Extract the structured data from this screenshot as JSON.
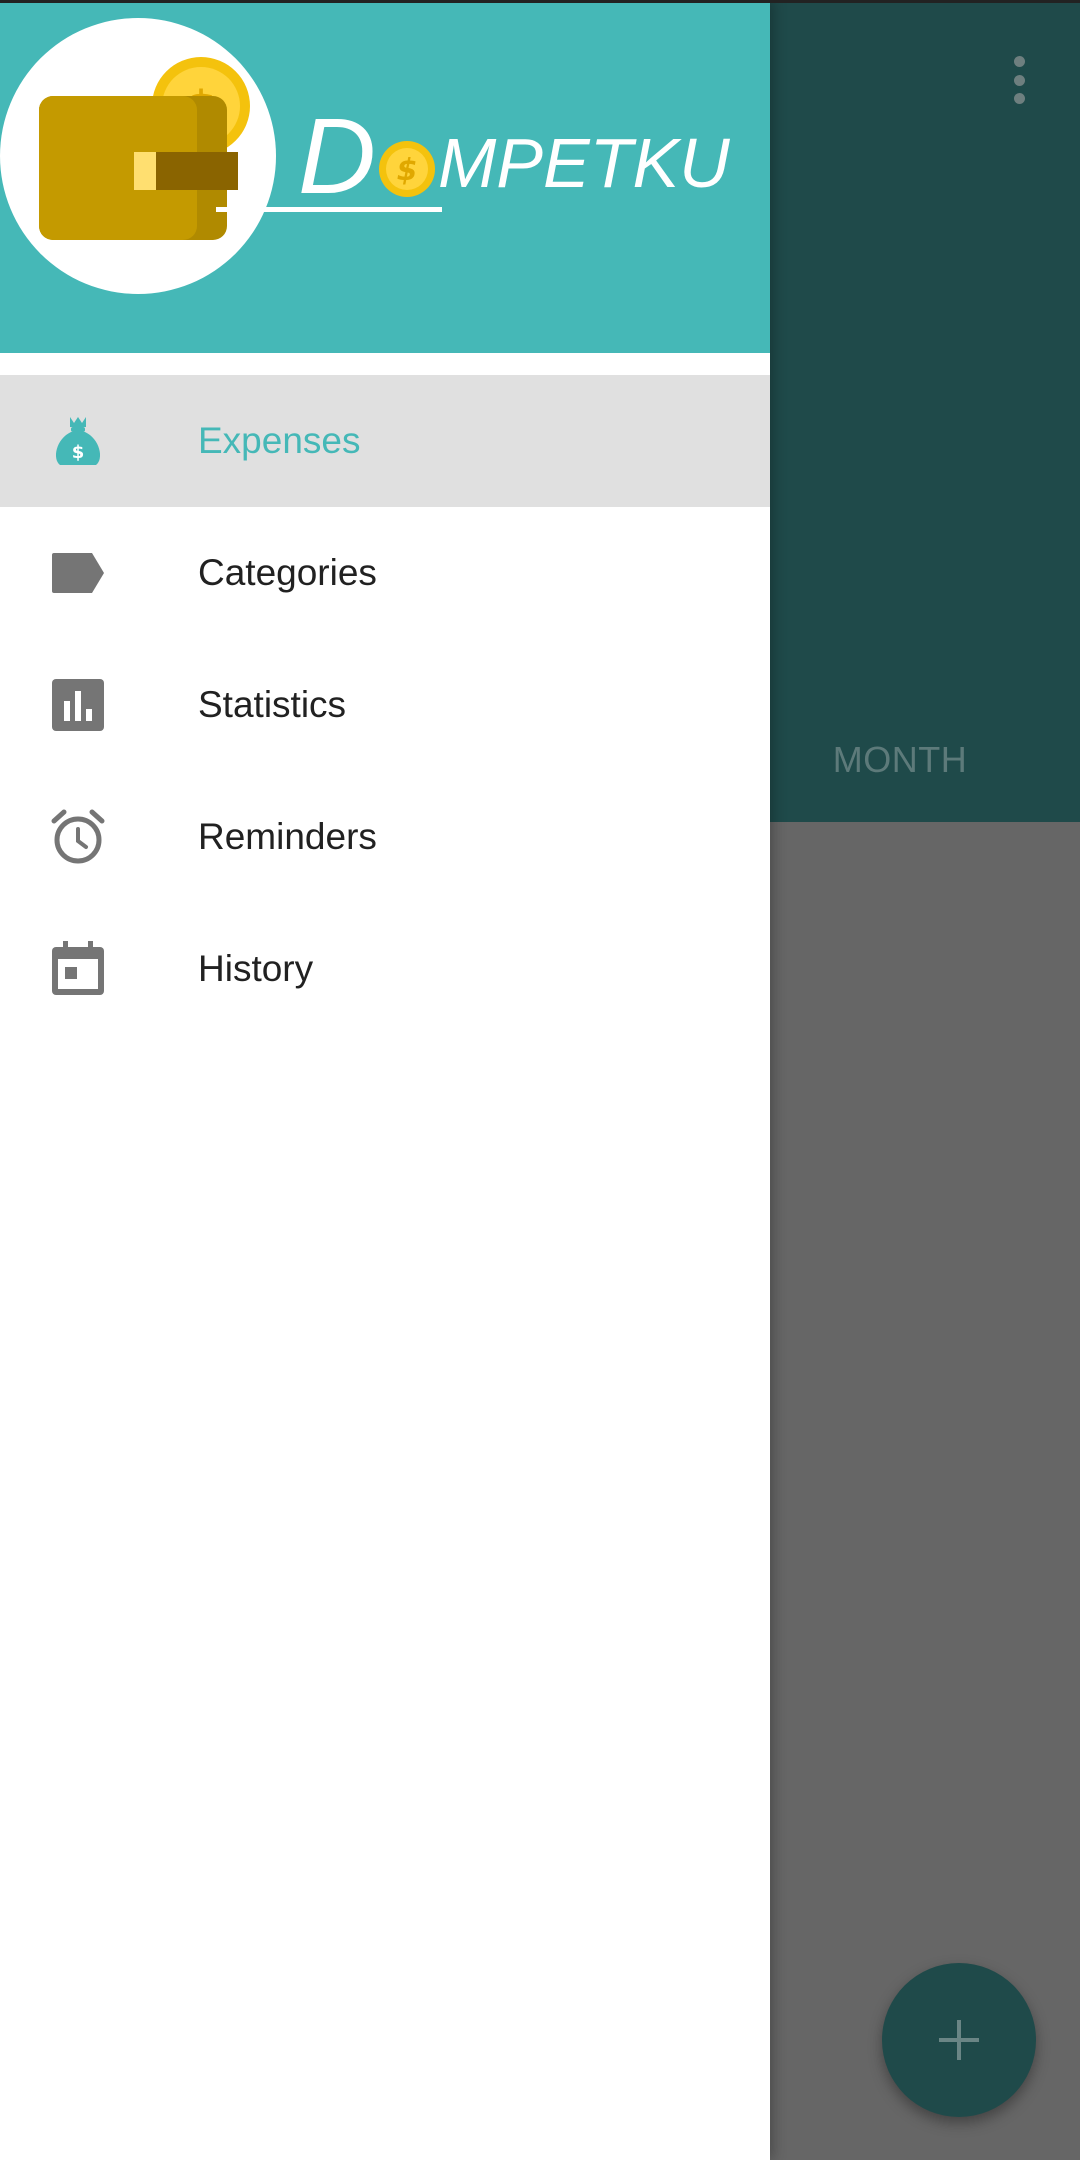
{
  "app": {
    "name_initial": "D",
    "name_rest": "MPETKU",
    "accent_color": "#45b8b7",
    "app_bar_color": "#1f4a4a"
  },
  "drawer": {
    "items": [
      {
        "label": "Expenses",
        "icon": "money-bag-icon",
        "active": true
      },
      {
        "label": "Categories",
        "icon": "label-tag-icon",
        "active": false
      },
      {
        "label": "Statistics",
        "icon": "bar-chart-icon",
        "active": false
      },
      {
        "label": "Reminders",
        "icon": "alarm-clock-icon",
        "active": false
      },
      {
        "label": "History",
        "icon": "calendar-icon",
        "active": false
      }
    ]
  },
  "background": {
    "tab_label": "MONTH",
    "fab_icon": "plus-icon"
  }
}
